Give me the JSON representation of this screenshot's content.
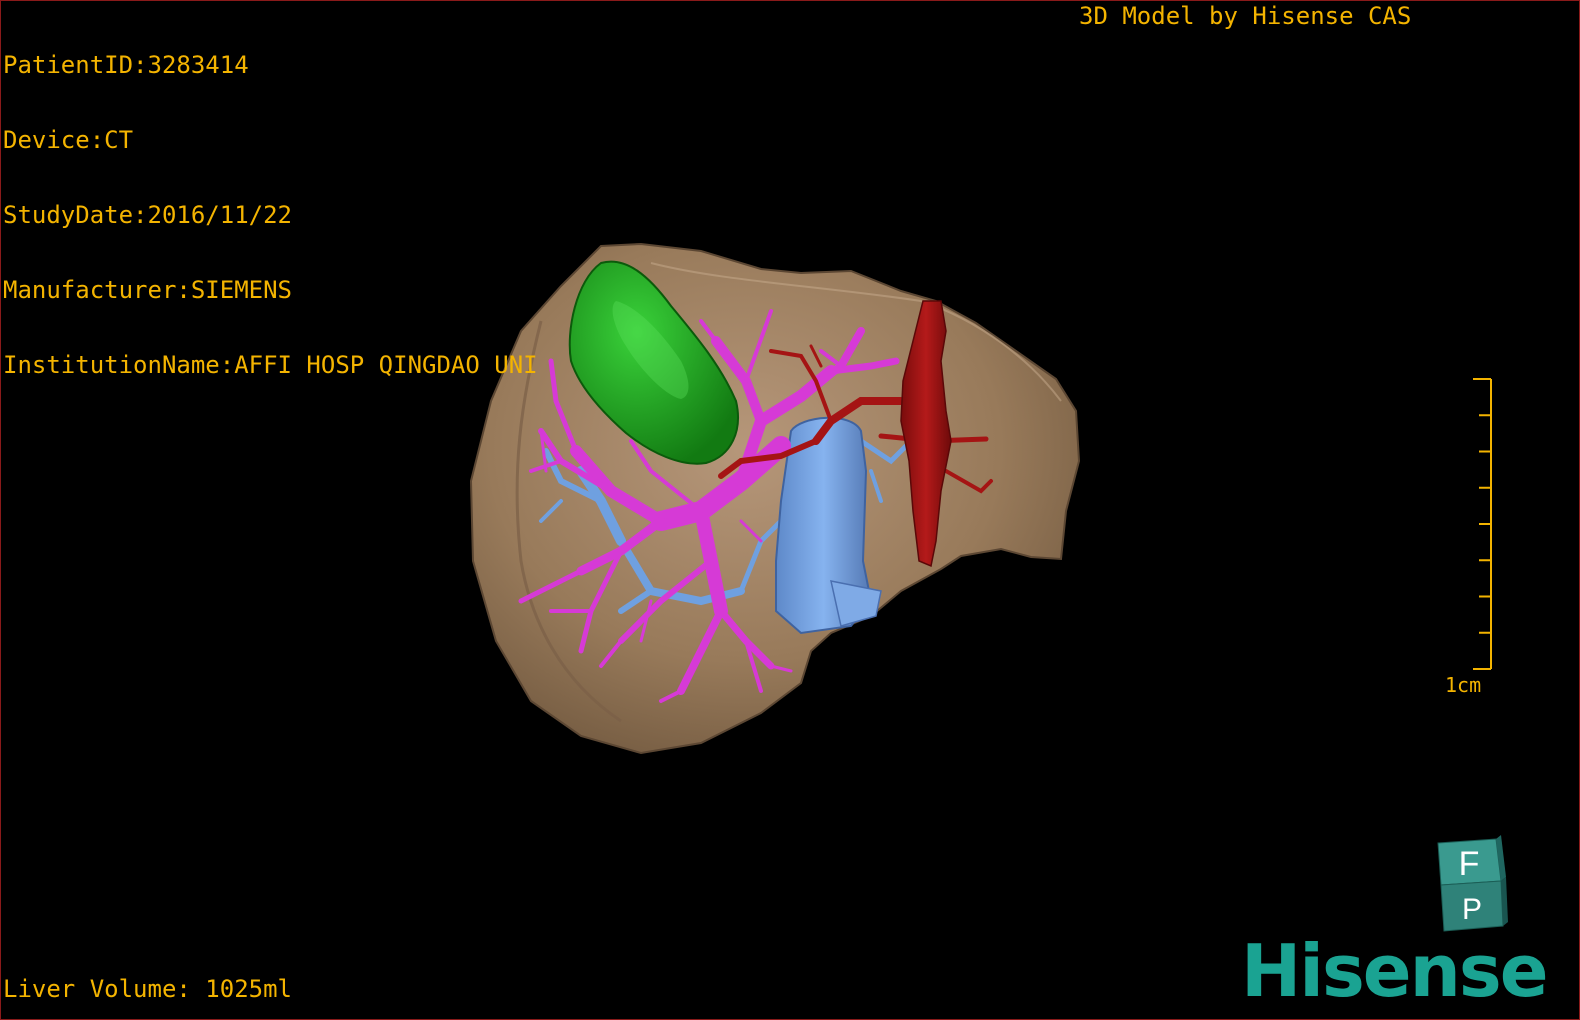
{
  "study_info": {
    "patient_id": "PatientID:3283414",
    "device": "Device:CT",
    "study_date": "StudyDate:2016/11/22",
    "manufacturer": "Manufacturer:SIEMENS",
    "institution": "InstitutionName:AFFI HOSP QINGDAO UNI"
  },
  "model_credit": "3D Model by Hisense CAS",
  "liver_volume": "Liver Volume: 1025ml",
  "scale": {
    "label": "1cm",
    "minor_ticks": 8
  },
  "orientation_cube": {
    "top_label": "F",
    "front_label": "P"
  },
  "brand": "Hisense",
  "colors": {
    "overlay_text": "#f4b400",
    "liver": "#9b7d5c",
    "tumor": "#1f9a1f",
    "portal_vein": "#d63ad6",
    "hepatic_vein": "#6fa0e0",
    "ivc": "#a01212",
    "brand": "#1aa392",
    "frame": "#8a1a1a"
  }
}
